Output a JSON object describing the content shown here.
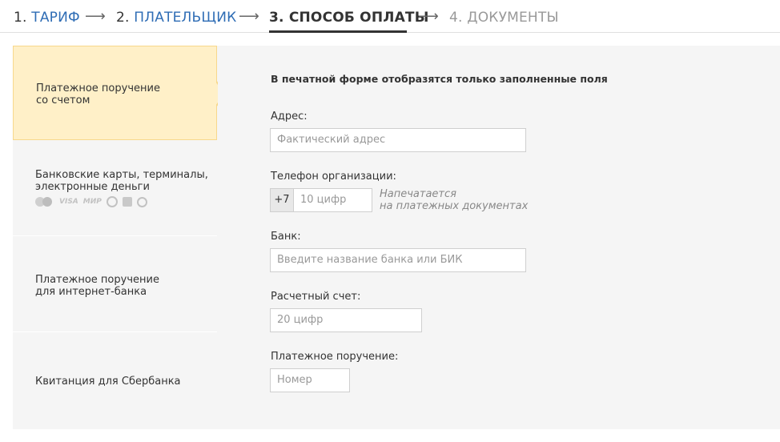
{
  "stepper": {
    "steps": [
      {
        "num": "1.",
        "label": "ТАРИФ",
        "state": "done"
      },
      {
        "num": "2.",
        "label": "ПЛАТЕЛЬЩИК",
        "state": "done"
      },
      {
        "num": "3.",
        "label": "СПОСОБ ОПЛАТЫ",
        "state": "current"
      },
      {
        "num": "4.",
        "label": "ДОКУМЕНТЫ",
        "state": "future"
      }
    ],
    "arrow": "⟶"
  },
  "sidebar": {
    "methods": [
      {
        "line1": "Платежное поручение",
        "line2": "со счетом",
        "active": true
      },
      {
        "line1": "Банковские карты, терминалы,",
        "line2": "электронные деньги",
        "icons": [
          "mastercard-icon",
          "visa-icon",
          "mir-icon",
          "webmoney-icon",
          "wallet-icon",
          "qiwi-icon"
        ]
      },
      {
        "line1": "Платежное поручение",
        "line2": "для интернет-банка"
      },
      {
        "line1": "Квитанция для Сбербанка",
        "line2": ""
      }
    ],
    "visa_text": "VISA",
    "mir_text": "МИР"
  },
  "form": {
    "notice": "В печатной форме отобразятся только заполненные поля",
    "address": {
      "label": "Адрес:",
      "placeholder": "Фактический адрес"
    },
    "phone": {
      "label": "Телефон организации:",
      "prefix": "+7",
      "placeholder": "10 цифр",
      "hint_line1": "Напечатается",
      "hint_line2": "на платежных документах"
    },
    "bank": {
      "label": "Банк:",
      "placeholder": "Введите название банка или БИК"
    },
    "account": {
      "label": "Расчетный счет:",
      "placeholder": "20 цифр"
    },
    "order": {
      "label": "Платежное поручение:",
      "placeholder": "Номер"
    }
  },
  "colors": {
    "accent": "#2f6db5",
    "active_bg": "#fff0c8",
    "active_border": "#f7d88c",
    "panel_bg": "#f5f5f5"
  }
}
